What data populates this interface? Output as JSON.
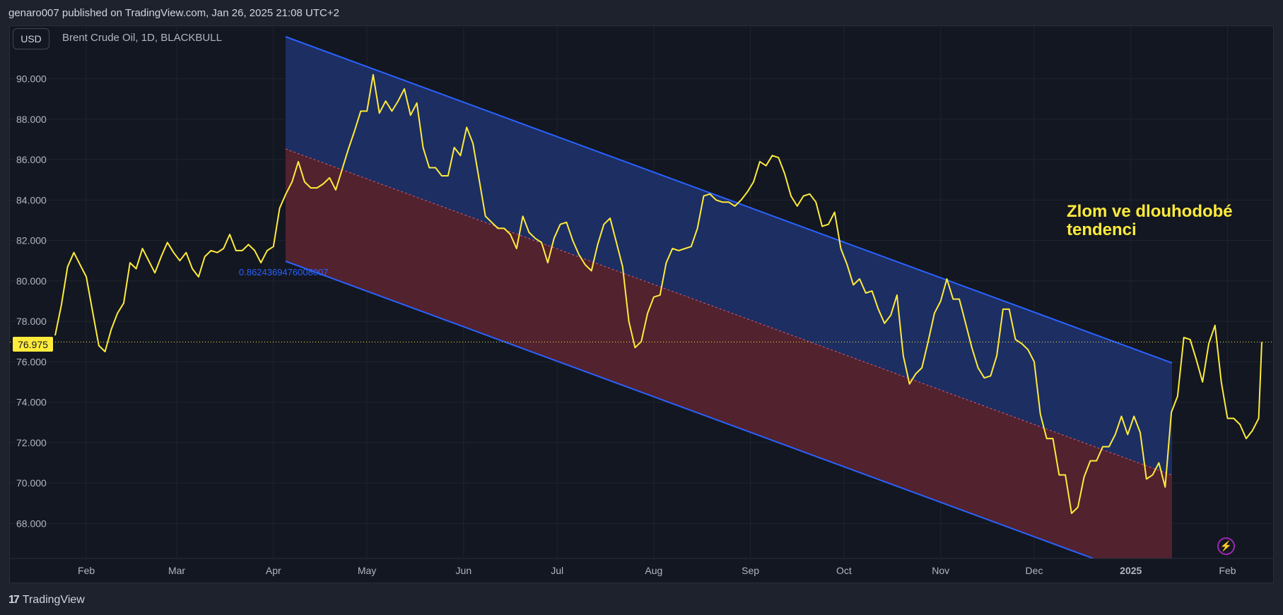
{
  "header": {
    "publisher_line": "genaro007 published on TradingView.com, Jan 26, 2025 21:08 UTC+2"
  },
  "toolbar": {
    "currency": "USD",
    "symbol": "Brent Crude Oil, 1D, BLACKBULL"
  },
  "annotation": {
    "line1": "Zlom ve dlouhodobé",
    "line2": "tendenci",
    "channel_value": "0.8624369476008007"
  },
  "current_price": "76.975",
  "footer": {
    "brand": "TradingView"
  },
  "colors": {
    "price_line": "#ffeb3b",
    "channel_line": "#2962ff",
    "upper_fill": "#1d2f66",
    "lower_fill": "#55232f",
    "grid": "#20242f",
    "background": "#131722"
  },
  "chart_data": {
    "type": "line",
    "title": "Brent Crude Oil, 1D, BLACKBULL",
    "y_ticks": [
      "90.000",
      "88.000",
      "86.000",
      "84.000",
      "82.000",
      "80.000",
      "78.000",
      "76.000",
      "74.000",
      "72.000",
      "70.000",
      "68.000"
    ],
    "x_ticks": [
      {
        "label": "Feb",
        "date": "2024-02-01"
      },
      {
        "label": "Mar",
        "date": "2024-03-01"
      },
      {
        "label": "Apr",
        "date": "2024-04-01"
      },
      {
        "label": "May",
        "date": "2024-05-01"
      },
      {
        "label": "Jun",
        "date": "2024-06-01"
      },
      {
        "label": "Jul",
        "date": "2024-07-01"
      },
      {
        "label": "Aug",
        "date": "2024-08-01"
      },
      {
        "label": "Sep",
        "date": "2024-09-01"
      },
      {
        "label": "Oct",
        "date": "2024-10-01"
      },
      {
        "label": "Nov",
        "date": "2024-11-01"
      },
      {
        "label": "Dec",
        "date": "2024-12-01"
      },
      {
        "label": "2025",
        "date": "2025-01-01"
      },
      {
        "label": "Feb",
        "date": "2025-02-01"
      }
    ],
    "ylim": [
      66.3,
      92.5
    ],
    "xlim": [
      "2024-01-22",
      "2025-02-12"
    ],
    "current_price": 76.975,
    "series": [
      {
        "points": [
          [
            "2024-01-22",
            77.3
          ],
          [
            "2024-01-24",
            78.8
          ],
          [
            "2024-01-26",
            80.7
          ],
          [
            "2024-01-28",
            81.4
          ],
          [
            "2024-01-30",
            80.8
          ],
          [
            "2024-02-01",
            80.2
          ],
          [
            "2024-02-03",
            78.5
          ],
          [
            "2024-02-05",
            76.8
          ],
          [
            "2024-02-07",
            76.5
          ],
          [
            "2024-02-09",
            77.6
          ],
          [
            "2024-02-11",
            78.4
          ],
          [
            "2024-02-13",
            78.9
          ],
          [
            "2024-02-15",
            80.9
          ],
          [
            "2024-02-17",
            80.6
          ],
          [
            "2024-02-19",
            81.6
          ],
          [
            "2024-02-21",
            81.0
          ],
          [
            "2024-02-23",
            80.4
          ],
          [
            "2024-02-25",
            81.2
          ],
          [
            "2024-02-27",
            81.9
          ],
          [
            "2024-02-29",
            81.4
          ],
          [
            "2024-03-02",
            81.0
          ],
          [
            "2024-03-04",
            81.4
          ],
          [
            "2024-03-06",
            80.6
          ],
          [
            "2024-03-08",
            80.2
          ],
          [
            "2024-03-10",
            81.2
          ],
          [
            "2024-03-12",
            81.5
          ],
          [
            "2024-03-14",
            81.4
          ],
          [
            "2024-03-16",
            81.6
          ],
          [
            "2024-03-18",
            82.3
          ],
          [
            "2024-03-20",
            81.5
          ],
          [
            "2024-03-22",
            81.5
          ],
          [
            "2024-03-24",
            81.8
          ],
          [
            "2024-03-26",
            81.5
          ],
          [
            "2024-03-28",
            80.9
          ],
          [
            "2024-03-30",
            81.5
          ],
          [
            "2024-04-01",
            81.7
          ],
          [
            "2024-04-03",
            83.6
          ],
          [
            "2024-04-05",
            84.3
          ],
          [
            "2024-04-07",
            84.9
          ],
          [
            "2024-04-09",
            85.9
          ],
          [
            "2024-04-11",
            84.9
          ],
          [
            "2024-04-13",
            84.6
          ],
          [
            "2024-04-15",
            84.6
          ],
          [
            "2024-04-17",
            84.8
          ],
          [
            "2024-04-19",
            85.1
          ],
          [
            "2024-04-21",
            84.5
          ],
          [
            "2024-04-23",
            85.5
          ],
          [
            "2024-04-25",
            86.5
          ],
          [
            "2024-04-27",
            87.4
          ],
          [
            "2024-04-29",
            88.4
          ],
          [
            "2024-05-01",
            88.4
          ],
          [
            "2024-05-03",
            90.2
          ],
          [
            "2024-05-05",
            88.3
          ],
          [
            "2024-05-07",
            88.9
          ],
          [
            "2024-05-09",
            88.4
          ],
          [
            "2024-05-11",
            88.9
          ],
          [
            "2024-05-13",
            89.5
          ],
          [
            "2024-05-15",
            88.2
          ],
          [
            "2024-05-17",
            88.8
          ],
          [
            "2024-05-19",
            86.6
          ],
          [
            "2024-05-21",
            85.6
          ],
          [
            "2024-05-23",
            85.6
          ],
          [
            "2024-05-25",
            85.2
          ],
          [
            "2024-05-27",
            85.2
          ],
          [
            "2024-05-29",
            86.6
          ],
          [
            "2024-05-31",
            86.2
          ],
          [
            "2024-06-02",
            87.6
          ],
          [
            "2024-06-04",
            86.8
          ],
          [
            "2024-06-06",
            85.0
          ],
          [
            "2024-06-08",
            83.2
          ],
          [
            "2024-06-10",
            82.9
          ],
          [
            "2024-06-12",
            82.6
          ],
          [
            "2024-06-14",
            82.6
          ],
          [
            "2024-06-16",
            82.3
          ],
          [
            "2024-06-18",
            81.6
          ],
          [
            "2024-06-20",
            83.2
          ],
          [
            "2024-06-22",
            82.4
          ],
          [
            "2024-06-24",
            82.1
          ],
          [
            "2024-06-26",
            81.9
          ],
          [
            "2024-06-28",
            80.9
          ],
          [
            "2024-06-30",
            82.1
          ],
          [
            "2024-07-02",
            82.8
          ],
          [
            "2024-07-04",
            82.9
          ],
          [
            "2024-07-06",
            82.0
          ],
          [
            "2024-07-08",
            81.3
          ],
          [
            "2024-07-10",
            80.8
          ],
          [
            "2024-07-12",
            80.5
          ],
          [
            "2024-07-14",
            81.8
          ],
          [
            "2024-07-16",
            82.8
          ],
          [
            "2024-07-18",
            83.1
          ],
          [
            "2024-07-20",
            81.9
          ],
          [
            "2024-07-22",
            80.7
          ],
          [
            "2024-07-24",
            78.0
          ],
          [
            "2024-07-26",
            76.7
          ],
          [
            "2024-07-28",
            77.0
          ],
          [
            "2024-07-30",
            78.4
          ],
          [
            "2024-08-01",
            79.2
          ],
          [
            "2024-08-03",
            79.3
          ],
          [
            "2024-08-05",
            80.9
          ],
          [
            "2024-08-07",
            81.6
          ],
          [
            "2024-08-09",
            81.5
          ],
          [
            "2024-08-11",
            81.6
          ],
          [
            "2024-08-13",
            81.7
          ],
          [
            "2024-08-15",
            82.6
          ],
          [
            "2024-08-17",
            84.2
          ],
          [
            "2024-08-19",
            84.3
          ],
          [
            "2024-08-21",
            84.0
          ],
          [
            "2024-08-23",
            83.9
          ],
          [
            "2024-08-25",
            83.9
          ],
          [
            "2024-08-27",
            83.7
          ],
          [
            "2024-08-29",
            84.0
          ],
          [
            "2024-08-31",
            84.4
          ],
          [
            "2024-09-02",
            84.9
          ],
          [
            "2024-09-04",
            85.9
          ],
          [
            "2024-09-06",
            85.7
          ],
          [
            "2024-09-08",
            86.2
          ],
          [
            "2024-09-10",
            86.1
          ],
          [
            "2024-09-12",
            85.3
          ],
          [
            "2024-09-14",
            84.2
          ],
          [
            "2024-09-16",
            83.7
          ],
          [
            "2024-09-18",
            84.2
          ],
          [
            "2024-09-20",
            84.3
          ],
          [
            "2024-09-22",
            83.9
          ],
          [
            "2024-09-24",
            82.7
          ],
          [
            "2024-09-26",
            82.8
          ],
          [
            "2024-09-28",
            83.4
          ],
          [
            "2024-09-30",
            81.6
          ],
          [
            "2024-10-02",
            80.8
          ],
          [
            "2024-10-04",
            79.8
          ],
          [
            "2024-10-06",
            80.1
          ],
          [
            "2024-10-08",
            79.4
          ],
          [
            "2024-10-10",
            79.5
          ],
          [
            "2024-10-12",
            78.6
          ],
          [
            "2024-10-14",
            77.9
          ],
          [
            "2024-10-16",
            78.3
          ],
          [
            "2024-10-18",
            79.3
          ],
          [
            "2024-10-20",
            76.3
          ],
          [
            "2024-10-22",
            74.9
          ],
          [
            "2024-10-24",
            75.4
          ],
          [
            "2024-10-26",
            75.7
          ],
          [
            "2024-10-28",
            77.0
          ],
          [
            "2024-10-30",
            78.4
          ],
          [
            "2024-11-01",
            79.0
          ],
          [
            "2024-11-03",
            80.1
          ],
          [
            "2024-11-05",
            79.1
          ],
          [
            "2024-11-07",
            79.1
          ],
          [
            "2024-11-09",
            77.9
          ],
          [
            "2024-11-11",
            76.7
          ],
          [
            "2024-11-13",
            75.7
          ],
          [
            "2024-11-15",
            75.2
          ],
          [
            "2024-11-17",
            75.3
          ],
          [
            "2024-11-19",
            76.3
          ],
          [
            "2024-11-21",
            78.6
          ],
          [
            "2024-11-23",
            78.6
          ],
          [
            "2024-11-25",
            77.1
          ],
          [
            "2024-11-27",
            76.9
          ],
          [
            "2024-11-29",
            76.6
          ],
          [
            "2024-12-01",
            76.0
          ],
          [
            "2024-12-03",
            73.4
          ],
          [
            "2024-12-05",
            72.2
          ],
          [
            "2024-12-07",
            72.2
          ],
          [
            "2024-12-09",
            70.4
          ],
          [
            "2024-12-11",
            70.4
          ],
          [
            "2024-12-13",
            68.5
          ],
          [
            "2024-12-15",
            68.8
          ],
          [
            "2024-12-17",
            70.3
          ],
          [
            "2024-12-19",
            71.1
          ],
          [
            "2024-12-21",
            71.1
          ],
          [
            "2024-12-23",
            71.8
          ],
          [
            "2024-12-25",
            71.8
          ],
          [
            "2024-12-27",
            72.4
          ],
          [
            "2024-12-29",
            73.3
          ],
          [
            "2024-12-31",
            72.4
          ],
          [
            "2025-01-02",
            73.3
          ],
          [
            "2025-01-04",
            72.5
          ],
          [
            "2025-01-06",
            70.2
          ],
          [
            "2025-01-08",
            70.4
          ],
          [
            "2025-01-10",
            71.0
          ],
          [
            "2025-01-12",
            69.8
          ],
          [
            "2025-01-14",
            73.5
          ],
          [
            "2025-01-16",
            74.3
          ],
          [
            "2025-01-18",
            77.2
          ],
          [
            "2025-01-20",
            77.1
          ],
          [
            "2025-01-22",
            76.1
          ],
          [
            "2025-01-24",
            75.0
          ],
          [
            "2025-01-26",
            76.9
          ],
          [
            "2025-01-28",
            77.8
          ],
          [
            "2025-01-30",
            75.0
          ],
          [
            "2025-02-01",
            73.2
          ],
          [
            "2025-02-03",
            73.2
          ],
          [
            "2025-02-05",
            72.9
          ],
          [
            "2025-02-07",
            72.2
          ],
          [
            "2025-02-09",
            72.6
          ],
          [
            "2025-02-11",
            73.2
          ],
          [
            "2025-02-12",
            76.975
          ]
        ]
      }
    ]
  }
}
